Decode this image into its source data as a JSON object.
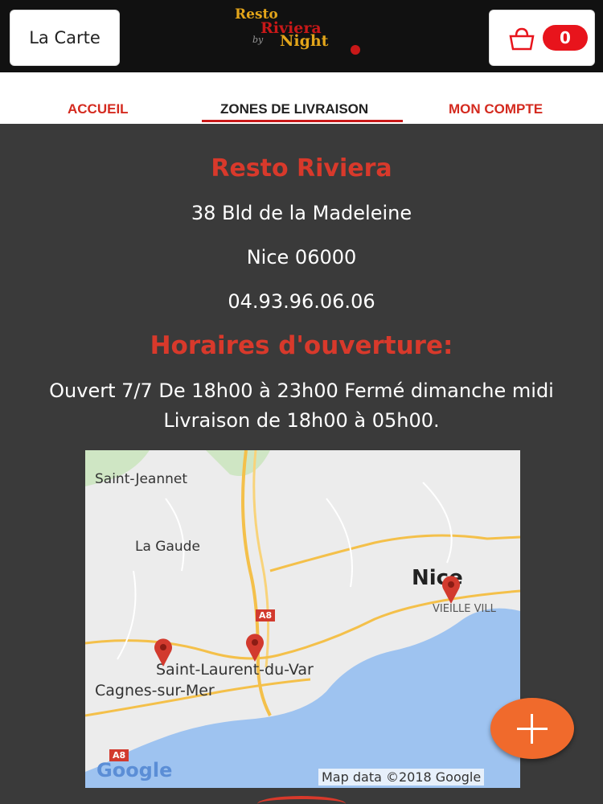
{
  "header": {
    "menu_button": "La Carte",
    "logo": {
      "line1": "Resto",
      "line2": "Riviera",
      "line3": "by",
      "line4": "Night"
    },
    "cart_count": "0",
    "cart_icon": "shopping-bag-icon"
  },
  "nav": {
    "tabs": [
      {
        "label": "ACCUEIL"
      },
      {
        "label": "ZONES DE LIVRAISON",
        "active": true
      },
      {
        "label": "MON COMPTE"
      }
    ]
  },
  "info": {
    "name": "Resto Riviera",
    "address": "38 Bld de la Madeleine",
    "city": "Nice 06000",
    "phone": "04.93.96.06.06",
    "hours_title": "Horaires d'ouverture:",
    "hours_line1": "Ouvert 7/7 De 18h00 à 23h00 Fermé dimanche midi",
    "hours_line2": "Livraison de 18h00 à 05h00."
  },
  "map": {
    "labels": {
      "saint_jeannet": "Saint-Jeannet",
      "la_gaude": "La Gaude",
      "nice": "Nice",
      "vieille_ville": "VIEILLE VILL",
      "saint_laurent": "Saint-Laurent-du-Var",
      "cagnes": "Cagnes-sur-Mer",
      "a8_1": "A8",
      "a8_2": "A8",
      "google": "Google",
      "map_data": "Map data ©2018 Google"
    },
    "marker_icon": "map-pin-icon",
    "colors": {
      "sea": "#9ec3f0",
      "land": "#ececec",
      "road": "#f4c04a",
      "pin": "#d23a2e"
    }
  },
  "fab": {
    "icon": "plus-icon"
  },
  "colors": {
    "accent": "#d8392b",
    "header_bg": "#111111",
    "content_bg": "#3a3a3a",
    "fab": "#f06a2c"
  }
}
